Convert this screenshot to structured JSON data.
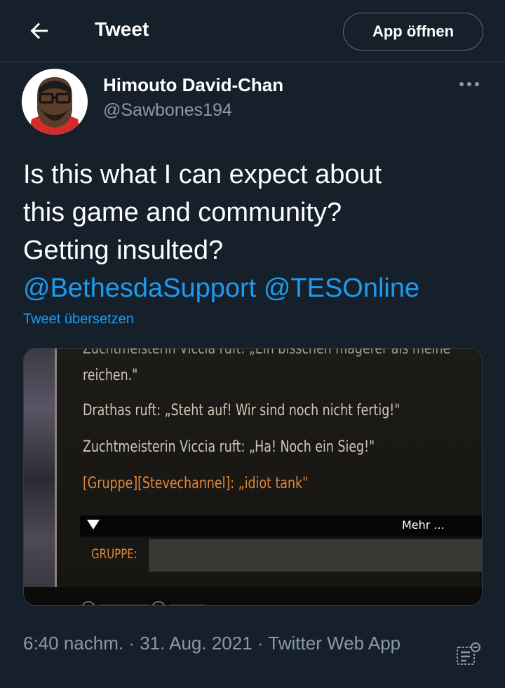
{
  "header": {
    "title": "Tweet",
    "open_app_label": "App öffnen"
  },
  "author": {
    "display_name": "Himouto David-Chan",
    "handle": "@Sawbones194"
  },
  "tweet": {
    "text_line1": "Is this what I can expect about",
    "text_line2": "this game and community?",
    "text_line3": "Getting insulted?",
    "mention1": "@BethesdaSupport",
    "mention2": "@TESOnline",
    "translate_label": "Tweet übersetzen"
  },
  "media": {
    "chat_line_cut": "Zuchtmeisterin Viccia ruft: „Ein bisschen magerer als meine",
    "chat_line_cont": "reichen.\"",
    "chat_line2": "Drathas ruft: „Steht auf! Wir sind noch nicht fertig!\"",
    "chat_line3": "Zuchtmeisterin Viccia ruft: „Ha! Noch ein Sieg!\"",
    "chat_line4": "[Gruppe][Stevechannel]: „idiot tank\"",
    "more_label": "Mehr ...",
    "channel_label": "GRUPPE:"
  },
  "meta": {
    "timestamp": "6:40 nachm. · 31. Aug. 2021 · Twitter Web App"
  },
  "colors": {
    "background": "#15202b",
    "link": "#1d9bf0",
    "muted": "#8b98a5",
    "game_orange": "#e2873a"
  }
}
